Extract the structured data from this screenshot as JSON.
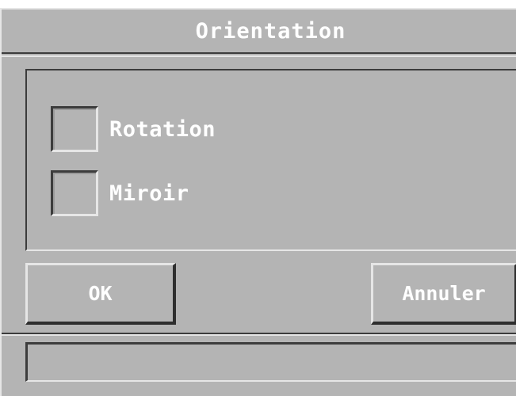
{
  "dialog": {
    "title": "Orientation"
  },
  "options": {
    "rotation": {
      "label": "Rotation",
      "checked": false
    },
    "miroir": {
      "label": "Miroir",
      "checked": false
    }
  },
  "buttons": {
    "ok_label": "OK",
    "cancel_label": "Annuler"
  },
  "status": {
    "text": ""
  },
  "colors": {
    "background": "#b4b4b4",
    "highlight": "#e6e6e6",
    "shadow": "#3c3c3c",
    "text": "#ffffff"
  }
}
